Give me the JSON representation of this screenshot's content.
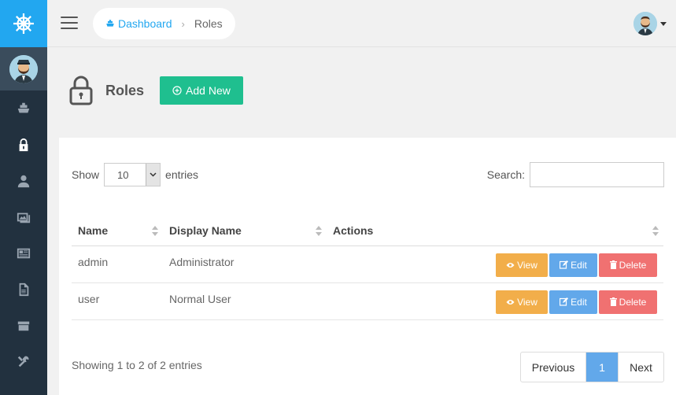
{
  "breadcrumb": {
    "home_label": "Dashboard",
    "current": "Roles"
  },
  "page": {
    "title": "Roles",
    "add_button": "Add New"
  },
  "table_controls": {
    "show_label": "Show",
    "entries_value": "10",
    "entries_label": "entries",
    "search_label": "Search:"
  },
  "table": {
    "headers": [
      "Name",
      "Display Name",
      "Actions"
    ],
    "rows": [
      {
        "name": "admin",
        "display_name": "Administrator"
      },
      {
        "name": "user",
        "display_name": "Normal User"
      }
    ],
    "action_labels": {
      "view": "View",
      "edit": "Edit",
      "delete": "Delete"
    }
  },
  "footer": {
    "info": "Showing 1 to 2 of 2 entries",
    "previous": "Previous",
    "page": "1",
    "next": "Next"
  },
  "sidebar": {
    "icons": [
      "ship-wheel-icon",
      "boat-icon",
      "lock-icon",
      "user-icon",
      "images-icon",
      "newspaper-icon",
      "file-icon",
      "archive-icon",
      "tools-icon"
    ]
  },
  "colors": {
    "accent": "#22a7f0",
    "sidebar": "#22313f",
    "add_button": "#1fbf8f",
    "view": "#f2ae4a",
    "edit": "#62a8ea",
    "delete": "#f07171"
  }
}
